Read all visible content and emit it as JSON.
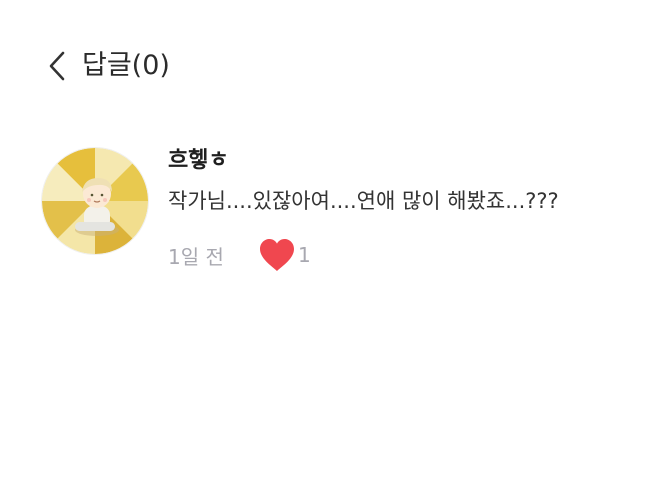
{
  "header": {
    "back_icon": "chevron-left-icon",
    "title": "답글(0)"
  },
  "comment": {
    "avatar_icon": "profile-illustration",
    "username": "흐헿ㅎ",
    "text": "작가님....있잖아여....연애 많이 해봤죠...???",
    "timestamp": "1일 전",
    "like_icon": "heart-icon",
    "like_count": "1"
  },
  "colors": {
    "heart": "#f0474f",
    "meta_text": "#a8a8b0",
    "avatar_yellow": "#e9c64a"
  }
}
